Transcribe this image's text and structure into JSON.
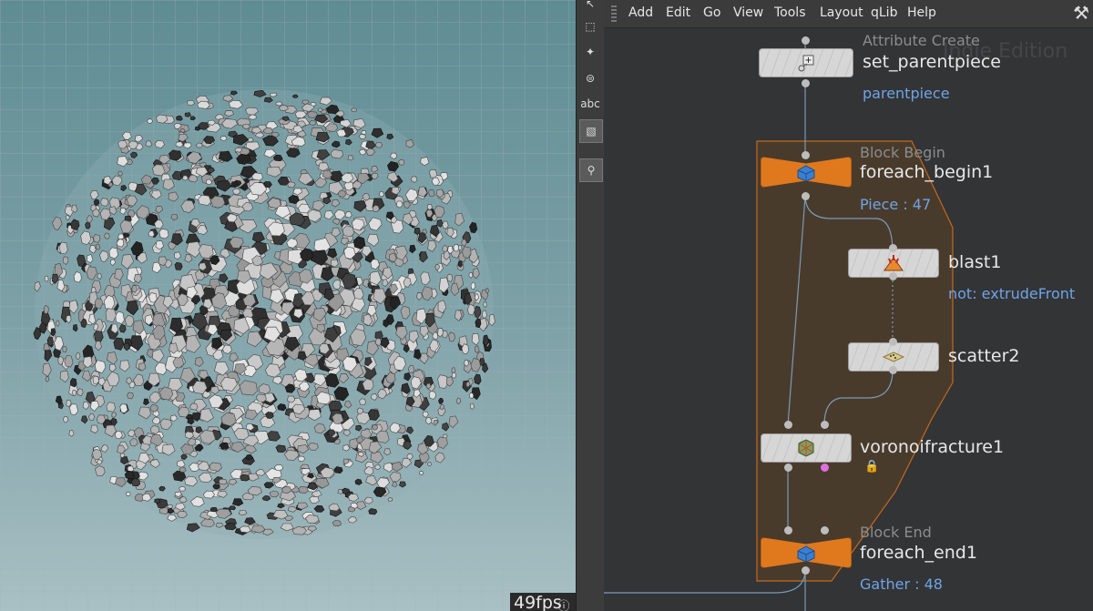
{
  "viewport": {
    "fps": "49fps"
  },
  "toolbar": {
    "text_tool_label": "abc"
  },
  "menu": {
    "items": [
      "Add",
      "Edit",
      "Go",
      "View",
      "Tools",
      "Layout",
      "qLib",
      "Help"
    ]
  },
  "network": {
    "watermark": "Indie Edition",
    "nodes": {
      "attribcreate": {
        "type": "Attribute Create",
        "name": "set_parentpiece",
        "comment": "parentpiece"
      },
      "foreach_begin": {
        "type": "Block Begin",
        "name": "foreach_begin1",
        "comment": "Piece : 47"
      },
      "blast": {
        "name": "blast1",
        "comment": "not: extrudeFront"
      },
      "scatter": {
        "name": "scatter2"
      },
      "voronoi": {
        "name": "voronoifracture1"
      },
      "foreach_end": {
        "type": "Block End",
        "name": "foreach_end1",
        "comment": "Gather : 48"
      }
    }
  },
  "colors": {
    "block_orange": "#e0781e",
    "comment_blue": "#6fa4e6",
    "viewport_bg": "#7fa2a8"
  }
}
